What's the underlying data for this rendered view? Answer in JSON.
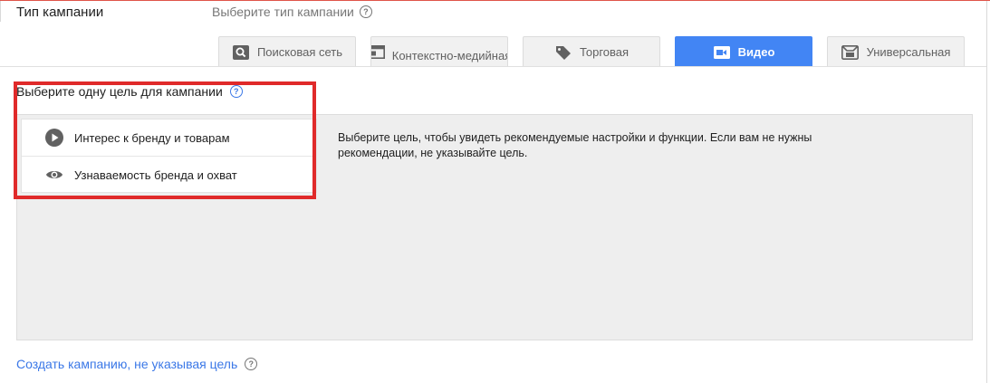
{
  "campaign_type": {
    "label": "Тип кампании",
    "hint": "Выберите тип кампании"
  },
  "tabs": [
    {
      "label": "Поисковая сеть",
      "icon": "search-icon",
      "active": false
    },
    {
      "label": "Контекстно-медийная",
      "icon": "display-icon",
      "active": false
    },
    {
      "label": "Торговая",
      "icon": "tag-icon",
      "active": false
    },
    {
      "label": "Видео",
      "icon": "video-camera-icon",
      "active": true
    },
    {
      "label": "Универсальная",
      "icon": "app-icon",
      "active": false
    }
  ],
  "goal": {
    "heading": "Выберите одну цель для кампании",
    "options": [
      {
        "label": "Интерес к бренду и товарам",
        "icon": "play-icon"
      },
      {
        "label": "Узнаваемость бренда и охват",
        "icon": "eye-icon"
      }
    ],
    "description": "Выберите цель, чтобы увидеть рекомендуемые настройки и функции. Если вам не нужны рекомендации, не указывайте цель."
  },
  "no_goal_link": "Создать кампанию, не указывая цель",
  "colors": {
    "accent": "#4285f4",
    "link": "#3b78e7",
    "highlight": "#e02a2a",
    "panel": "#eeeeee"
  }
}
